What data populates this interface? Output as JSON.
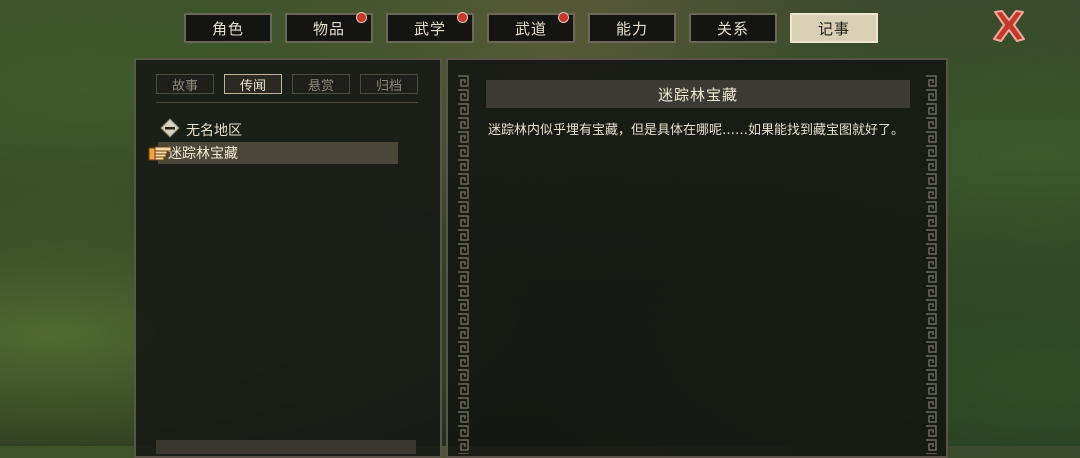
{
  "tabs": [
    {
      "label": "角色",
      "badge": false,
      "active": false
    },
    {
      "label": "物品",
      "badge": true,
      "active": false
    },
    {
      "label": "武学",
      "badge": true,
      "active": false
    },
    {
      "label": "武道",
      "badge": true,
      "active": false
    },
    {
      "label": "能力",
      "badge": false,
      "active": false
    },
    {
      "label": "关系",
      "badge": false,
      "active": false
    },
    {
      "label": "记事",
      "badge": false,
      "active": true
    }
  ],
  "close_icon": "close-x-icon",
  "subtabs": [
    {
      "label": "故事",
      "active": false
    },
    {
      "label": "传闻",
      "active": true
    },
    {
      "label": "悬赏",
      "active": false
    },
    {
      "label": "归档",
      "active": false
    }
  ],
  "journal": {
    "region_label": "无名地区",
    "quest_label": "迷踪林宝藏"
  },
  "detail": {
    "title": "迷踪林宝藏",
    "description": "迷踪林内似乎埋有宝藏，但是具体在哪呢……如果能找到藏宝图就好了。"
  },
  "colors": {
    "accent_active_tab": "#d9cfb4",
    "badge": "#c23a2e",
    "close_icon": "#c0392b"
  }
}
